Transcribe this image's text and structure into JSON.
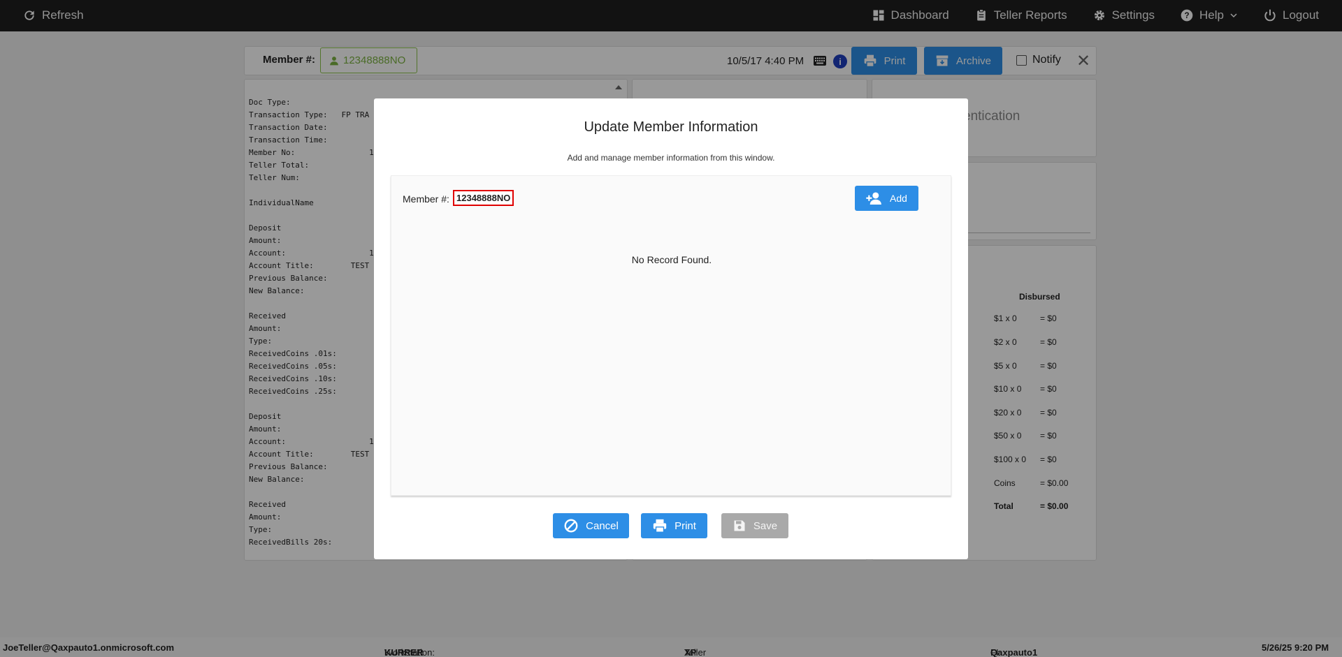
{
  "topbar": {
    "refresh": "Refresh",
    "dashboard": "Dashboard",
    "teller_reports": "Teller Reports",
    "settings": "Settings",
    "help": "Help",
    "logout": "Logout"
  },
  "header": {
    "member_label": "Member #:",
    "member_value": "12348888NO",
    "datetime": "10/5/17 4:40 PM",
    "info": "i",
    "print": "Print",
    "archive": "Archive",
    "notify": "Notify",
    "close": "✕"
  },
  "receipt": {
    "text": "Doc Type:\nTransaction Type:   FP TRA\nTransaction Date:\nTransaction Time:\nMember No:                12\nTeller Total:\nTeller Num:\n\nIndividualName\n\nDeposit\nAmount:\nAccount:                  12\nAccount Title:        TEST\nPrevious Balance:\nNew Balance:\n\nReceived\nAmount:\nType:\nReceivedCoins .01s:\nReceivedCoins .05s:\nReceivedCoins .10s:\nReceivedCoins .25s:\n\nDeposit\nAmount:\nAccount:                  12\nAccount Title:        TEST\nPrevious Balance:\nNew Balance:\n\nReceived\nAmount:\nType:\nReceivedBills 20s:"
  },
  "auth": {
    "title": "entication"
  },
  "disbursed": {
    "heading": "Disbursed",
    "rows": [
      {
        "a": "$1 x 0",
        "b": "= $0"
      },
      {
        "a": "$2 x 0",
        "b": "= $0"
      },
      {
        "a": "$5 x 0",
        "b": "= $0"
      },
      {
        "a": "$10 x 0",
        "b": "= $0"
      },
      {
        "a": "$20 x 0",
        "b": "= $0"
      },
      {
        "a": "$50 x 0",
        "b": "= $0"
      },
      {
        "a": "$100 x 0",
        "b": "= $0"
      },
      {
        "a": "Coins",
        "b": "= $0.00"
      },
      {
        "a": "Total",
        "b": "= $0.00"
      }
    ]
  },
  "modal": {
    "title": "Update Member Information",
    "subtitle": "Add and manage member information from this window.",
    "member_label": "Member #:",
    "member_value": "12348888NO",
    "add": "Add",
    "no_record": "No Record Found.",
    "cancel": "Cancel",
    "print": "Print",
    "save": "Save"
  },
  "footer": {
    "user": "JoeTeller@Qaxpauto1.onmicrosoft.com",
    "workstation_label": "Workstation: ",
    "workstation": "KURRER",
    "platform_label": "Teller Platform: ",
    "platform": "XP",
    "fi_label": "FI: ",
    "fi": "Qaxpauto1",
    "datetime": "5/26/25 9:20 PM"
  }
}
